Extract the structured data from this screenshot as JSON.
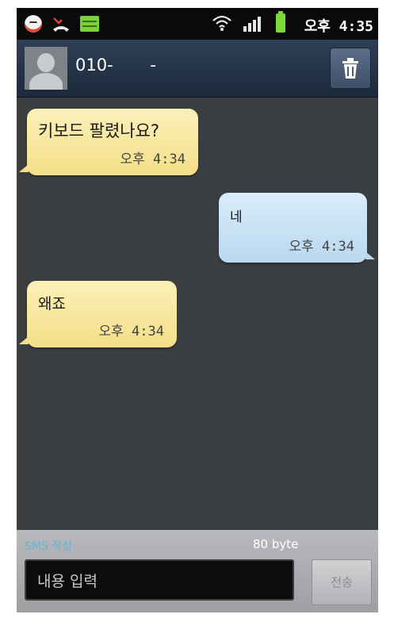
{
  "status_bar": {
    "clock": "오후 4:35",
    "icons": [
      "avatar-notification-icon",
      "missed-call-icon",
      "sms-notification-icon",
      "wifi-icon",
      "signal-icon",
      "battery-icon"
    ]
  },
  "header": {
    "contact_name": "010-       -",
    "delete_icon": "trash-icon"
  },
  "messages": [
    {
      "direction": "incoming",
      "text": "키보드 팔렸나요?",
      "time": "오후 4:34"
    },
    {
      "direction": "outgoing",
      "text": "네",
      "time": "오후 4:34"
    },
    {
      "direction": "incoming",
      "text": "왜죠",
      "time": "오후 4:34"
    }
  ],
  "composer": {
    "mode_label": "SMS 작성",
    "byte_count": "80 byte",
    "placeholder": "내용 입력",
    "send_label": "전송"
  },
  "colors": {
    "background": "#3b3e40",
    "incoming_bubble": "#f4df88",
    "outgoing_bubble": "#b9d8ef",
    "header": "#24344a",
    "sms_label": "#5fb6d9"
  }
}
